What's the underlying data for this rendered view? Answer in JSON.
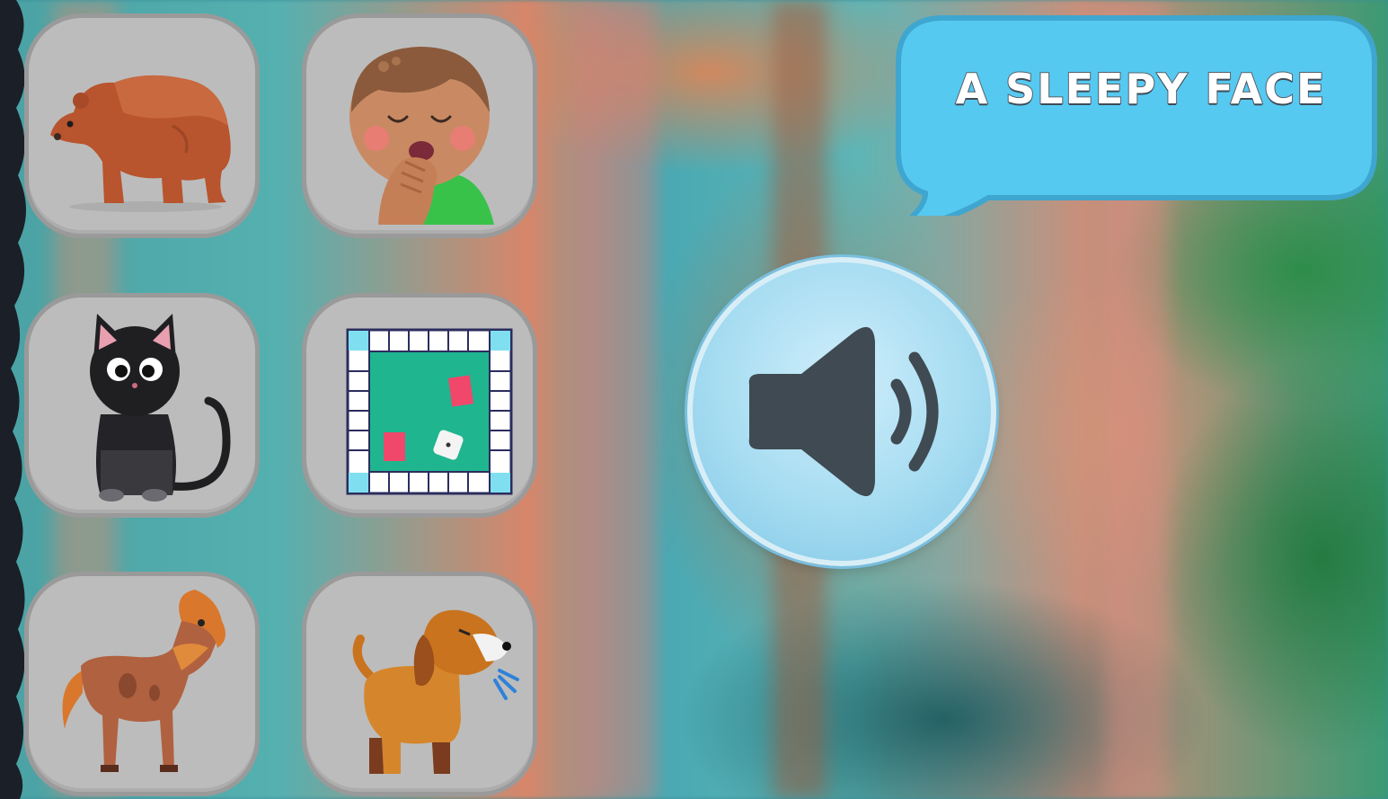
{
  "prompt": {
    "text": "A SLEEPY FACE",
    "bubble_color": "#56c9f1",
    "text_color": "#ffffff"
  },
  "tiles": [
    {
      "name": "bear",
      "icon": "bear-icon"
    },
    {
      "name": "sleepy-boy",
      "icon": "sleepy-face-icon"
    },
    {
      "name": "black-cat",
      "icon": "cat-icon"
    },
    {
      "name": "board-game",
      "icon": "board-game-icon"
    },
    {
      "name": "horse",
      "icon": "horse-icon"
    },
    {
      "name": "barking-dog",
      "icon": "dog-icon"
    }
  ],
  "speaker": {
    "icon": "speaker-icon",
    "color": "#3f4a52"
  },
  "colors": {
    "tile_bg": "#bcbcbc",
    "tile_border": "#9a9a9a"
  }
}
